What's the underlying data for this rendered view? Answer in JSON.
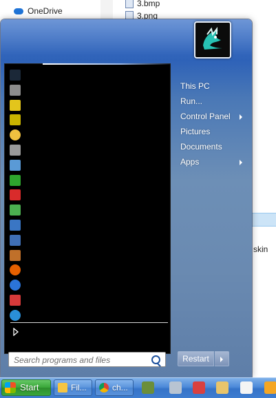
{
  "explorer": {
    "nav": {
      "onedrive_label": "OneDrive"
    },
    "files": [
      "3.bmp",
      "3.png"
    ],
    "partial_text": "skin"
  },
  "start_menu": {
    "programs": [
      {
        "icon": "steam-icon",
        "color": "#1b2838"
      },
      {
        "icon": "device-icon",
        "color": "#8c8c8c"
      },
      {
        "icon": "tool-x-icon",
        "color": "#e3c51c"
      },
      {
        "icon": "counter-icon",
        "color": "#c9b400"
      },
      {
        "icon": "clock-icon",
        "color": "#f0c040"
      },
      {
        "icon": "satellite-icon",
        "color": "#9a9a9a"
      },
      {
        "icon": "monitor-icon",
        "color": "#5a9ad6"
      },
      {
        "icon": "green-app-icon",
        "color": "#2ea52e"
      },
      {
        "icon": "pdf-icon",
        "color": "#d92b2b"
      },
      {
        "icon": "arch-icon",
        "color": "#4caf50"
      },
      {
        "icon": "editor-icon",
        "color": "#3a76c4"
      },
      {
        "icon": "virtualbox-icon",
        "color": "#3f6fb6"
      },
      {
        "icon": "film-icon",
        "color": "#c0702a"
      },
      {
        "icon": "firefox-icon",
        "color": "#e66000"
      },
      {
        "icon": "e-icon",
        "color": "#2b74d8"
      },
      {
        "icon": "piano-icon",
        "color": "#d63a3a"
      },
      {
        "icon": "swirl-icon",
        "color": "#2a8fd8"
      }
    ],
    "search": {
      "placeholder": "Search programs and files"
    },
    "right_items": [
      {
        "label": "This PC",
        "submenu": false
      },
      {
        "label": "Run...",
        "submenu": false
      },
      {
        "label": "Control Panel",
        "submenu": true
      },
      {
        "label": "Pictures",
        "submenu": false
      },
      {
        "label": "Documents",
        "submenu": false
      },
      {
        "label": "Apps",
        "submenu": true
      }
    ],
    "restart_label": "Restart"
  },
  "taskbar": {
    "start_label": "Start",
    "tasks": [
      {
        "label": "Fil...",
        "icon": "folder-icon",
        "color": "#f5c542"
      },
      {
        "label": "ch...",
        "icon": "chrome-icon",
        "color": "#e9b81c"
      }
    ],
    "pinned": [
      {
        "icon": "minecraft-icon",
        "color": "#6b8e3a"
      },
      {
        "icon": "funnel-icon",
        "color": "#b8c4d2"
      },
      {
        "icon": "paint-icon",
        "color": "#d94040"
      },
      {
        "icon": "package-icon",
        "color": "#e8c46a"
      },
      {
        "icon": "window-icon",
        "color": "#f4f4f4"
      },
      {
        "icon": "blender-icon",
        "color": "#f5a623"
      }
    ]
  }
}
